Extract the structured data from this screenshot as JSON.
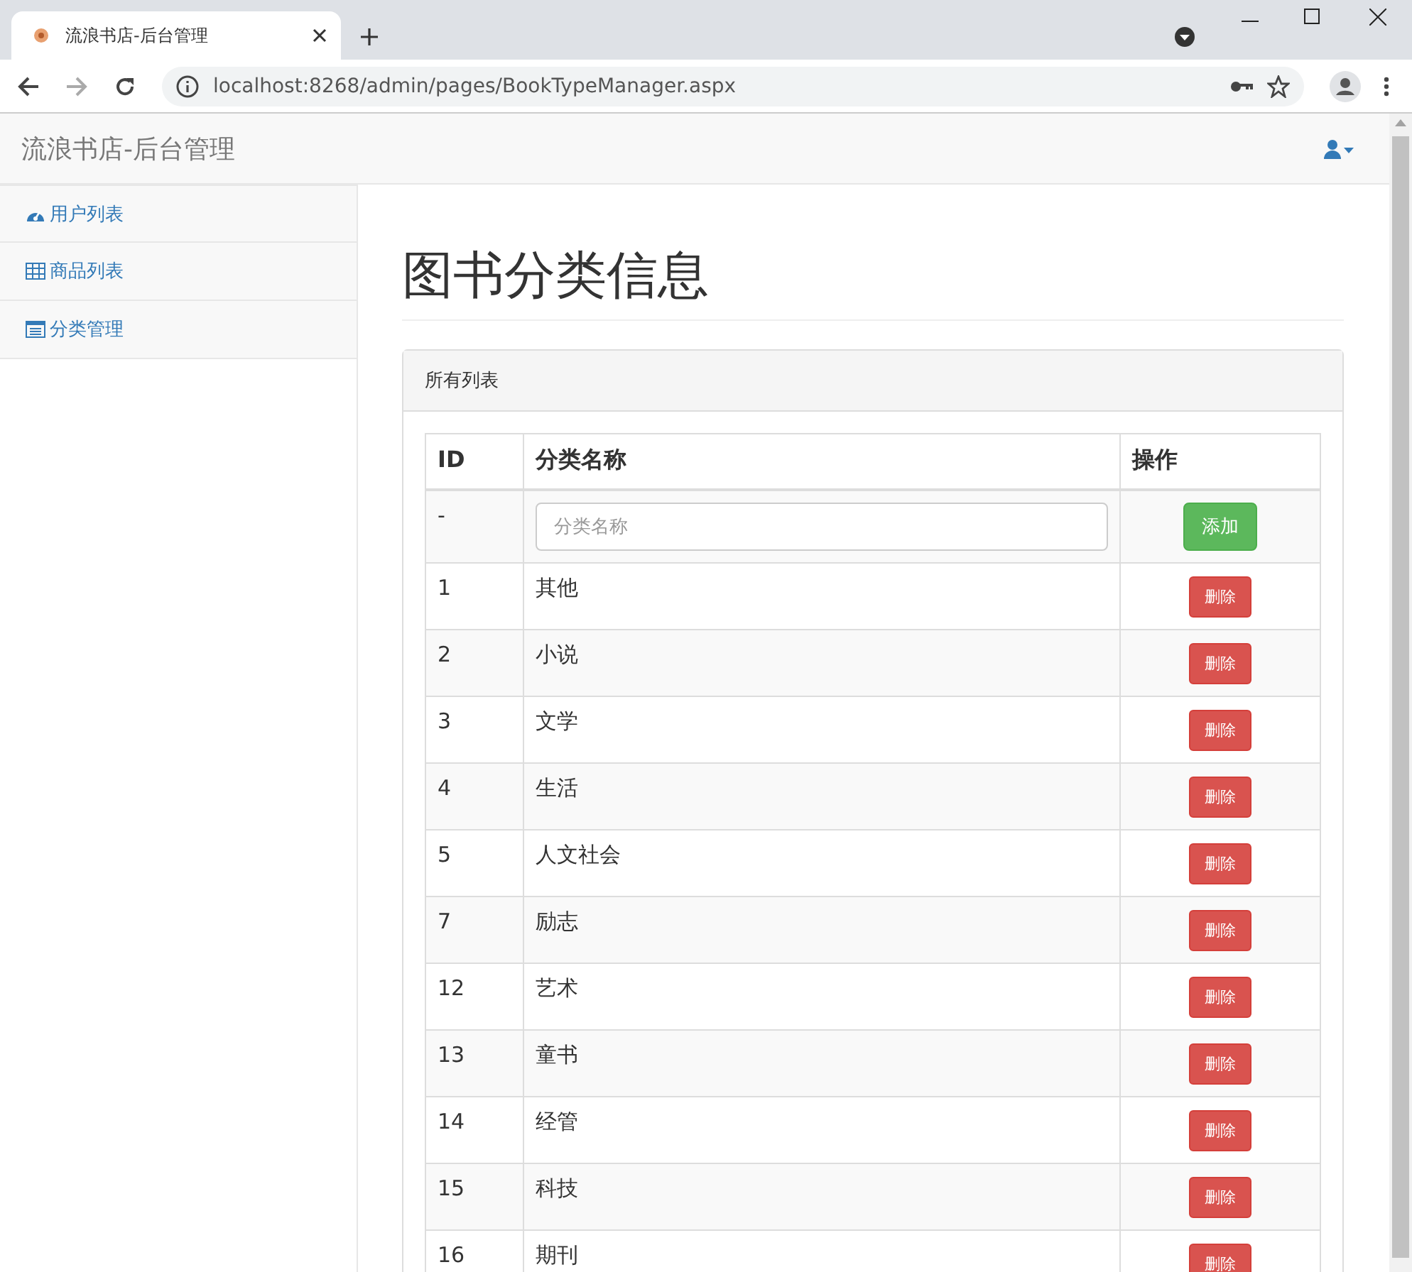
{
  "browser": {
    "tab_title": "流浪书店-后台管理",
    "url": "localhost:8268/admin/pages/BookTypeManager.aspx"
  },
  "navbar": {
    "brand": "流浪书店-后台管理"
  },
  "sidebar": {
    "items": [
      {
        "label": "用户列表",
        "kind": "dashboard"
      },
      {
        "label": "商品列表",
        "kind": "table"
      },
      {
        "label": "分类管理",
        "kind": "list"
      }
    ]
  },
  "page": {
    "title": "图书分类信息"
  },
  "panel": {
    "heading": "所有列表",
    "table": {
      "columns": [
        "ID",
        "分类名称",
        "操作"
      ],
      "new_row": {
        "id": "-",
        "placeholder": "分类名称",
        "button": "添加"
      },
      "rows": [
        {
          "id": "1",
          "name": "其他",
          "action": "删除"
        },
        {
          "id": "2",
          "name": "小说",
          "action": "删除"
        },
        {
          "id": "3",
          "name": "文学",
          "action": "删除"
        },
        {
          "id": "4",
          "name": "生活",
          "action": "删除"
        },
        {
          "id": "5",
          "name": "人文社会",
          "action": "删除"
        },
        {
          "id": "7",
          "name": "励志",
          "action": "删除"
        },
        {
          "id": "12",
          "name": "艺术",
          "action": "删除"
        },
        {
          "id": "13",
          "name": "童书",
          "action": "删除"
        },
        {
          "id": "14",
          "name": "经管",
          "action": "删除"
        },
        {
          "id": "15",
          "name": "科技",
          "action": "删除"
        },
        {
          "id": "16",
          "name": "期刊",
          "action": "删除"
        }
      ]
    }
  }
}
